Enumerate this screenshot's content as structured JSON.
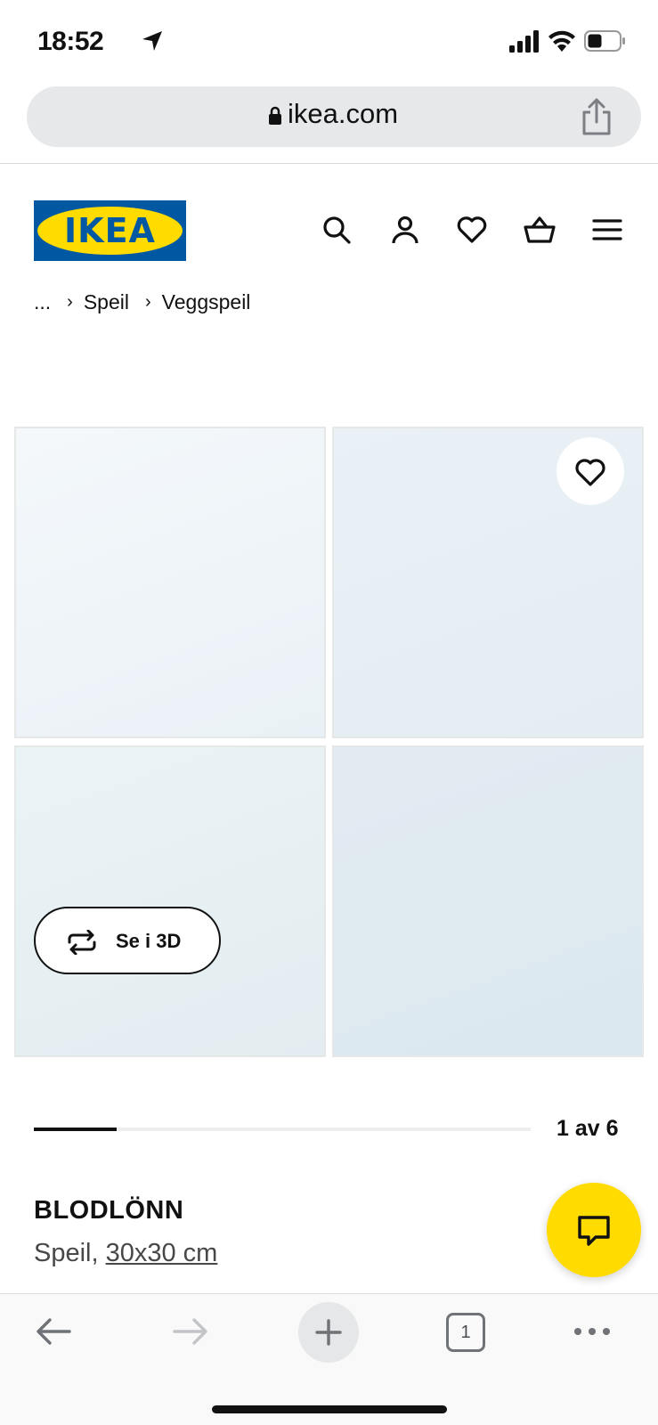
{
  "status_bar": {
    "time": "18:52",
    "icons": [
      "location-arrow-icon",
      "cellular-signal-icon",
      "wifi-icon",
      "battery-icon"
    ]
  },
  "browser": {
    "url": "ikea.com",
    "icons": [
      "lock-icon",
      "share-icon"
    ]
  },
  "site_header": {
    "logo_text": "IKEA",
    "logo_mark": "®",
    "icons": [
      "search-icon",
      "profile-icon",
      "heart-icon",
      "basket-icon",
      "menu-icon"
    ],
    "brand_colors": {
      "blue": "#0058a3",
      "yellow": "#ffdb00"
    }
  },
  "breadcrumb": {
    "items": [
      "...",
      "Speil",
      "Veggspeil"
    ]
  },
  "gallery": {
    "view_3d_label": "Se i 3D",
    "pager_label": "1 av 6",
    "progress_fraction": 0.1667
  },
  "product": {
    "name": "BLODLÖNN",
    "type": "Speil,",
    "size": "30x30 cm"
  },
  "toolbar": {
    "tab_count": "1",
    "icons": [
      "back-arrow-icon",
      "forward-arrow-icon",
      "plus-icon",
      "tabs-icon",
      "more-icon"
    ]
  }
}
